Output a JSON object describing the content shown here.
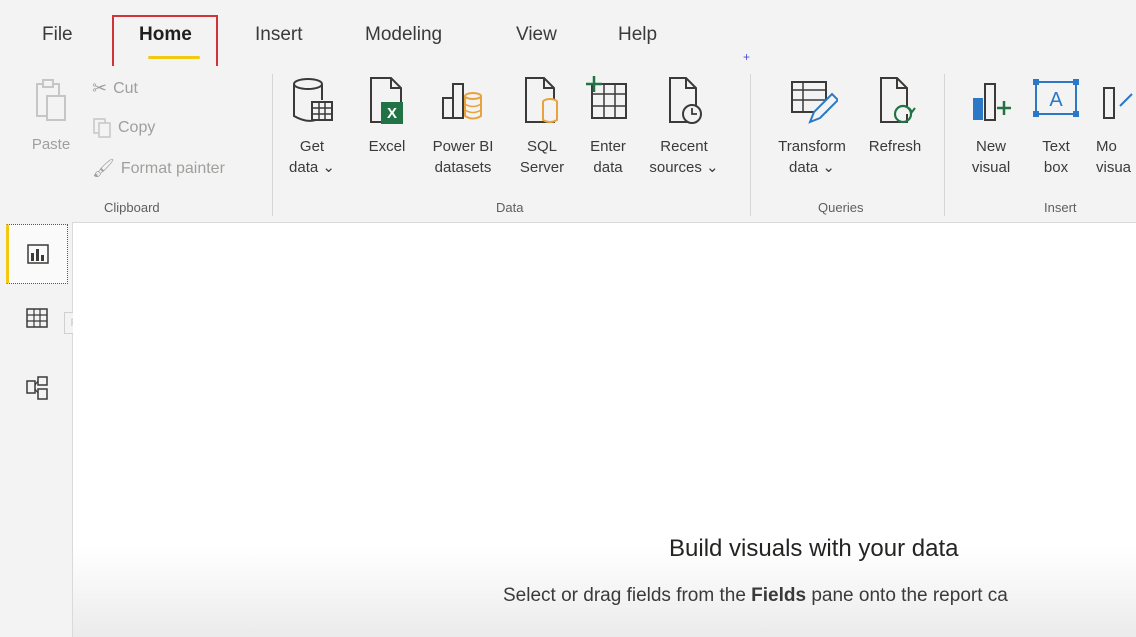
{
  "tabs": [
    {
      "label": "File"
    },
    {
      "label": "Home"
    },
    {
      "label": "Insert"
    },
    {
      "label": "Modeling"
    },
    {
      "label": "View"
    },
    {
      "label": "Help"
    }
  ],
  "ribbon": {
    "clipboard": {
      "group_label": "Clipboard",
      "paste": "Paste",
      "cut": "Cut",
      "copy": "Copy",
      "format_painter": "Format painter"
    },
    "data": {
      "group_label": "Data",
      "get_data": [
        "Get",
        "data ⌄"
      ],
      "excel": [
        "Excel"
      ],
      "power_bi_datasets": [
        "Power BI",
        "datasets"
      ],
      "sql_server": [
        "SQL",
        "Server"
      ],
      "enter_data": [
        "Enter",
        "data"
      ],
      "recent_sources": [
        "Recent",
        "sources ⌄"
      ]
    },
    "queries": {
      "group_label": "Queries",
      "transform_data": [
        "Transform",
        "data ⌄"
      ],
      "refresh": [
        "Refresh"
      ]
    },
    "insert": {
      "group_label": "Insert",
      "new_visual": [
        "New",
        "visual"
      ],
      "text_box": [
        "Text",
        "box"
      ],
      "more_visuals": [
        "Mo",
        "visua"
      ]
    }
  },
  "leftnav": {
    "tooltip": "Report"
  },
  "canvas": {
    "title": "Build visuals with your data",
    "subtitle_pre": "Select or drag fields from the ",
    "subtitle_bold": "Fields",
    "subtitle_post": " pane onto the report ca"
  },
  "colors": {
    "accent_yellow": "#f2c811",
    "highlight_red": "#d13438",
    "excel_green": "#217346",
    "icon_blue": "#2b78c6"
  }
}
